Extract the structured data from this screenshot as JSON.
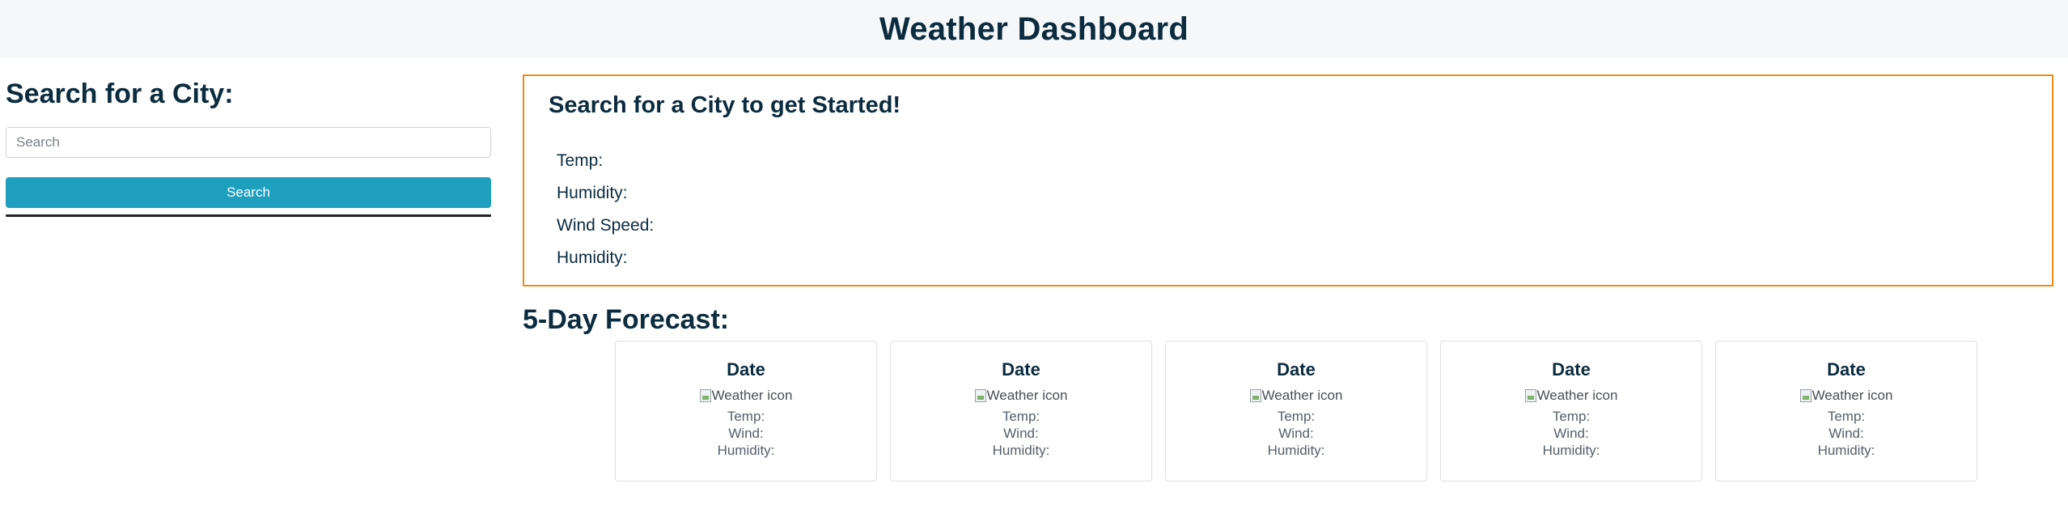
{
  "header": {
    "title": "Weather Dashboard"
  },
  "sidebar": {
    "heading": "Search for a City:",
    "search_placeholder": "Search",
    "search_button": "Search"
  },
  "current": {
    "heading": "Search for a City to get Started!",
    "temp_label": "Temp:",
    "humidity_label": "Humidity:",
    "wind_label": "Wind Speed:",
    "humidity2_label": "Humidity:"
  },
  "forecast": {
    "heading": "5-Day Forecast:",
    "cards": [
      {
        "date": "Date",
        "icon_alt": "Weather icon",
        "temp": "Temp:",
        "wind": "Wind:",
        "humidity": "Humidity:"
      },
      {
        "date": "Date",
        "icon_alt": "Weather icon",
        "temp": "Temp:",
        "wind": "Wind:",
        "humidity": "Humidity:"
      },
      {
        "date": "Date",
        "icon_alt": "Weather icon",
        "temp": "Temp:",
        "wind": "Wind:",
        "humidity": "Humidity:"
      },
      {
        "date": "Date",
        "icon_alt": "Weather icon",
        "temp": "Temp:",
        "wind": "Wind:",
        "humidity": "Humidity:"
      },
      {
        "date": "Date",
        "icon_alt": "Weather icon",
        "temp": "Temp:",
        "wind": "Wind:",
        "humidity": "Humidity:"
      }
    ]
  },
  "colors": {
    "accent": "#1f9fbe",
    "current_border": "#f08a17",
    "text": "#0b2b3f",
    "header_bg": "#f6f7f9"
  }
}
